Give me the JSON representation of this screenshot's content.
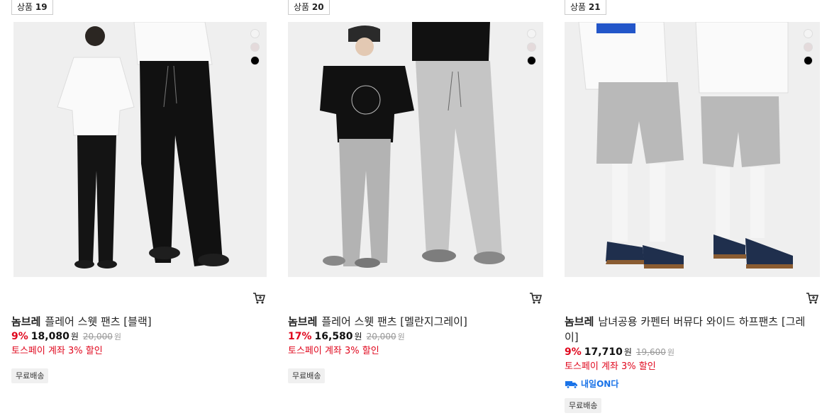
{
  "products": [
    {
      "tag_prefix": "상품",
      "tag_number": "19",
      "brand": "놈브레",
      "name": "플레어 스웻 팬츠 [블랙]",
      "discount": "9%",
      "price": "18,080",
      "currency": "원",
      "original_price": "20,000",
      "original_currency": "원",
      "promo": "토스페이 계좌 3% 할인",
      "badge": "무료배송",
      "swatches": [
        "#f4f4f4",
        "#e4dadb",
        "#000000"
      ]
    },
    {
      "tag_prefix": "상품",
      "tag_number": "20",
      "brand": "놈브레",
      "name": "플레어 스웻 팬츠 [멜란지그레이]",
      "discount": "17%",
      "price": "16,580",
      "currency": "원",
      "original_price": "20,000",
      "original_currency": "원",
      "promo": "토스페이 계좌 3% 할인",
      "badge": "무료배송",
      "swatches": [
        "#f4f4f4",
        "#e4dadb",
        "#000000"
      ]
    },
    {
      "tag_prefix": "상품",
      "tag_number": "21",
      "brand": "놈브레",
      "name": "남녀공용 카펜터 버뮤다 와이드 하프팬츠 [그레이]",
      "discount": "9%",
      "price": "17,710",
      "currency": "원",
      "original_price": "19,600",
      "original_currency": "원",
      "promo": "토스페이 계좌 3% 할인",
      "delivery_label": "내일ON다",
      "badge": "무료배송",
      "swatches": [
        "#f4f4f4",
        "#e4dadb",
        "#000000"
      ]
    }
  ],
  "icons": {
    "cart": "cart-icon",
    "delivery": "truck-icon"
  },
  "colors": {
    "discount": "#e0081e",
    "promo": "#e0081e",
    "delivery": "#1a73e8"
  }
}
